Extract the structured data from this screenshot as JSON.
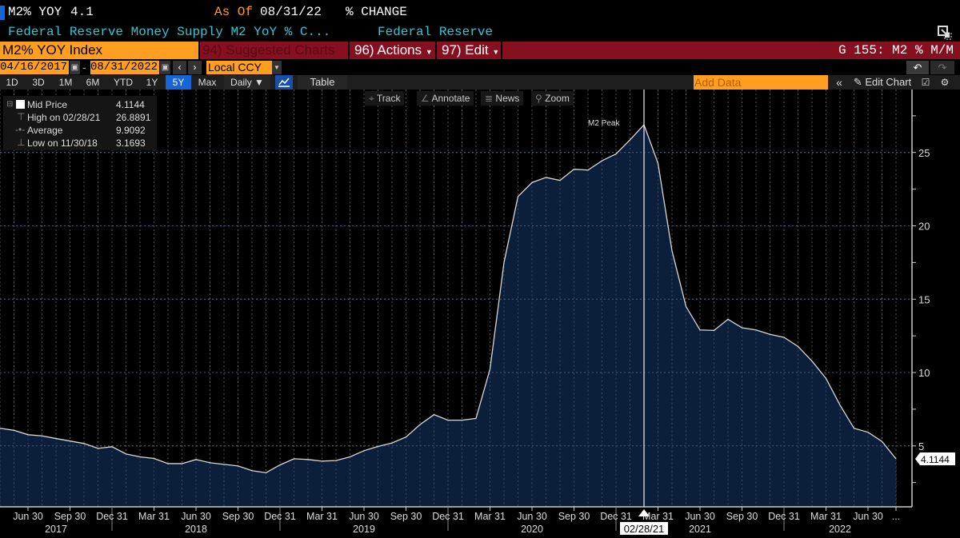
{
  "header": {
    "ticker": "M2% YOY",
    "last_value": "4.1",
    "as_of_label": "As Of",
    "as_of_date": "08/31/22",
    "units": "% CHANGE",
    "description": "Federal Reserve Money Supply M2 YoY % C...",
    "source": "Federal Reserve"
  },
  "command_bar": {
    "security": "M2% YOY Index",
    "suggested": "94) Suggested Charts",
    "actions": "96) Actions",
    "edit": "97) Edit",
    "chart_id": "G 155: M2 % M/M"
  },
  "range_bar": {
    "start_date": "04/16/2017",
    "separator": "-",
    "end_date": "08/31/2022",
    "currency": "Local CCY"
  },
  "toolbar": {
    "periods": [
      "1D",
      "3D",
      "1M",
      "6M",
      "YTD",
      "1Y",
      "5Y",
      "Max"
    ],
    "active_period": "5Y",
    "frequency": "Daily ▼",
    "table": "Table",
    "add_data_placeholder": "Add Data",
    "edit_chart": "Edit Chart"
  },
  "chart_tools": {
    "track": "Track",
    "annotate": "Annotate",
    "news": "News",
    "zoom": "Zoom"
  },
  "legend": {
    "mid_label": "Mid Price",
    "mid_value": "4.1144",
    "high_label": "High on 02/28/21",
    "high_value": "26.8891",
    "avg_label": "Average",
    "avg_value": "9.9092",
    "low_label": "Low on 11/30/18",
    "low_value": "3.1693"
  },
  "colors": {
    "accent": "#ff9e1f",
    "bar_red": "#861020",
    "area_fill": "#0b1e3a",
    "line": "#d8d8d8",
    "cyan": "#33c6d6"
  },
  "chart_data": {
    "type": "area",
    "title": "M2% YOY Index",
    "series": [
      {
        "name": "Mid Price",
        "x": [
          "2017-04",
          "2017-05",
          "2017-06",
          "2017-07",
          "2017-08",
          "2017-09",
          "2017-10",
          "2017-11",
          "2017-12",
          "2018-01",
          "2018-02",
          "2018-03",
          "2018-04",
          "2018-05",
          "2018-06",
          "2018-07",
          "2018-08",
          "2018-09",
          "2018-10",
          "2018-11",
          "2018-12",
          "2019-01",
          "2019-02",
          "2019-03",
          "2019-04",
          "2019-05",
          "2019-06",
          "2019-07",
          "2019-08",
          "2019-09",
          "2019-10",
          "2019-11",
          "2019-12",
          "2020-01",
          "2020-02",
          "2020-03",
          "2020-04",
          "2020-05",
          "2020-06",
          "2020-07",
          "2020-08",
          "2020-09",
          "2020-10",
          "2020-11",
          "2020-12",
          "2021-01",
          "2021-02",
          "2021-03",
          "2021-04",
          "2021-05",
          "2021-06",
          "2021-07",
          "2021-08",
          "2021-09",
          "2021-10",
          "2021-11",
          "2021-12",
          "2022-01",
          "2022-02",
          "2022-03",
          "2022-04",
          "2022-05",
          "2022-06",
          "2022-07",
          "2022-08"
        ],
        "values": [
          6.2,
          6.06,
          5.76,
          5.68,
          5.5,
          5.33,
          5.16,
          4.83,
          4.94,
          4.45,
          4.25,
          4.14,
          3.79,
          3.79,
          4.07,
          3.85,
          3.74,
          3.63,
          3.31,
          3.1693,
          3.7,
          4.12,
          4.07,
          3.96,
          4.0,
          4.25,
          4.67,
          4.96,
          5.2,
          5.6,
          6.45,
          7.13,
          6.75,
          6.75,
          6.87,
          10.23,
          17.5,
          22.0,
          22.95,
          23.3,
          23.1,
          23.86,
          23.8,
          24.44,
          24.9,
          25.86,
          26.8891,
          24.26,
          18.3,
          14.5,
          12.9,
          12.87,
          13.63,
          13.05,
          12.9,
          12.6,
          12.4,
          11.78,
          10.78,
          9.6,
          7.78,
          6.2,
          5.93,
          5.3,
          4.1144
        ]
      }
    ],
    "x_tick_labels": [
      "Jun 30",
      "Sep 30",
      "Dec 31",
      "Mar 31",
      "Jun 30",
      "Sep 30",
      "Dec 31",
      "Mar 31",
      "Jun 30",
      "Sep 30",
      "Dec 31",
      "Mar 31",
      "Jun 30",
      "Sep 30",
      "Dec 31",
      "Mar 31",
      "Jun 30",
      "Sep 30",
      "Dec 31",
      "Mar 31",
      "Jun 30",
      "..."
    ],
    "year_labels": [
      "2017",
      "2018",
      "2019",
      "2020",
      "2021",
      "2022"
    ],
    "y_ticks": [
      "5",
      "10",
      "15",
      "20",
      "25"
    ],
    "ylim": [
      0.8,
      29
    ],
    "grid": true,
    "annotation": {
      "text": "M2 Peak",
      "date_label": "02/28/21",
      "index": 46
    },
    "last_value_label": "4.1144",
    "legend_position": "top-left"
  }
}
